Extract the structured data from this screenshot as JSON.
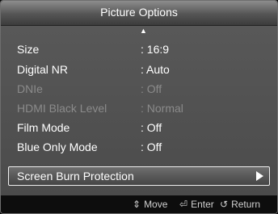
{
  "title": "Picture Options",
  "menu": {
    "scroll_up_icon": "▲",
    "items": [
      {
        "label": "Size",
        "value": ": 16:9",
        "enabled": true
      },
      {
        "label": "Digital NR",
        "value": ": Auto",
        "enabled": true
      },
      {
        "label": "DNIe",
        "value": ": Off",
        "enabled": false
      },
      {
        "label": "HDMI Black Level",
        "value": ": Normal",
        "enabled": false
      },
      {
        "label": "Film Mode",
        "value": ": Off",
        "enabled": true
      },
      {
        "label": "Blue Only Mode",
        "value": ": Off",
        "enabled": true
      },
      {
        "label": "Screen Burn Protection",
        "value": "",
        "enabled": true,
        "selected": true
      }
    ]
  },
  "footer": {
    "move": {
      "icon": "⇕",
      "label": "Move"
    },
    "enter": {
      "icon": "⏎",
      "label": "Enter"
    },
    "return": {
      "icon": "↺",
      "label": "Return"
    }
  },
  "colors": {
    "menu_background": "#525252",
    "text": "#ffffff",
    "disabled_text": "#8b8b8b",
    "footer_background": "#0d0d0d"
  }
}
